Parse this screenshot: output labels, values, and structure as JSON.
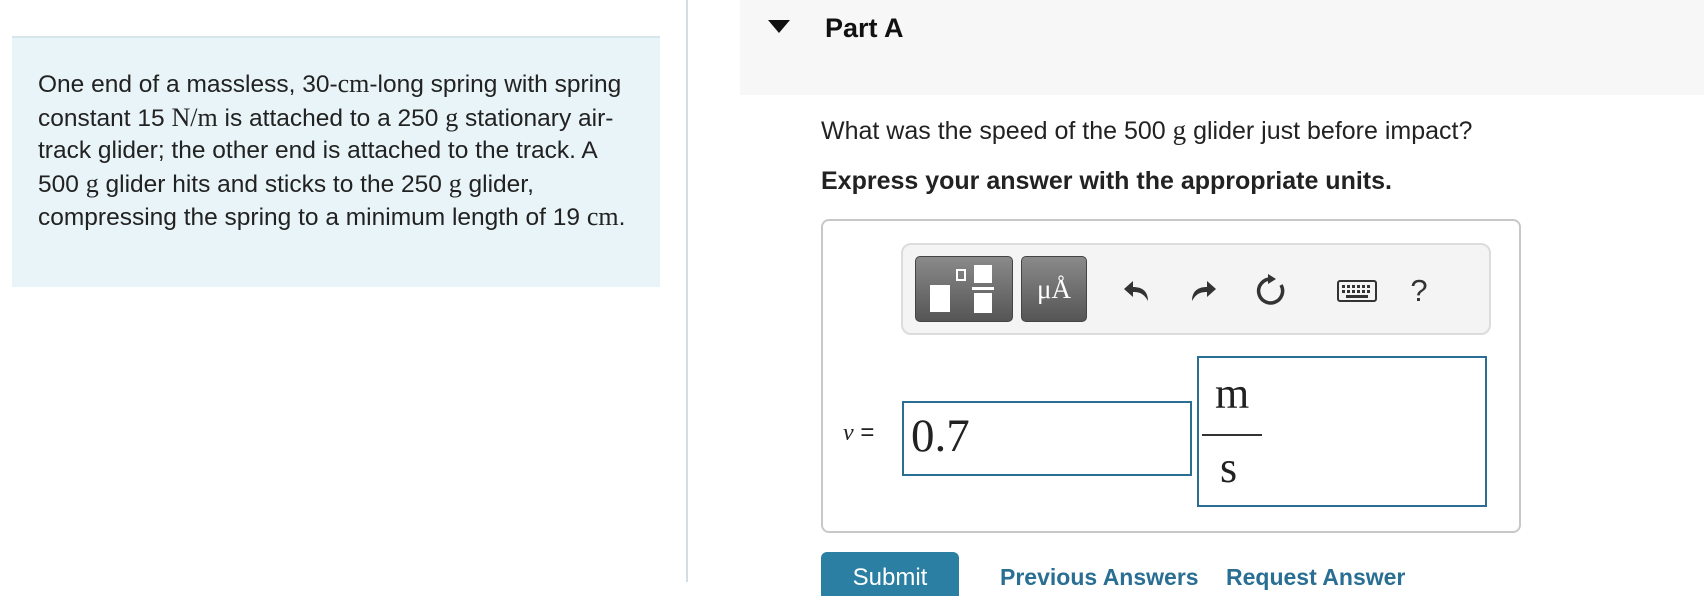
{
  "problem": {
    "text_parts": [
      "One end of a massless, 30-",
      "cm",
      "-long spring with spring constant 15 ",
      "N/m",
      " is attached to a 250 ",
      "g",
      " stationary air-track glider; the other end is attached to the track. A 500 ",
      "g",
      " glider hits and sticks to the 250 ",
      "g",
      " glider, compressing the spring to a minimum length of 19 ",
      "cm",
      "."
    ]
  },
  "part": {
    "title": "Part A"
  },
  "question": {
    "before": "What was the speed of the 500 ",
    "unit": "g",
    "after": " glider just before impact?"
  },
  "instruction": "Express your answer with the appropriate units.",
  "toolbar": {
    "units_button_label": "μÅ",
    "help_label": "?"
  },
  "answer": {
    "variable": "v",
    "equals": "=",
    "value": "0.7",
    "unit_numerator": "m",
    "unit_denominator": "s"
  },
  "actions": {
    "submit_label": "Submit",
    "previous_answers_label": "Previous Answers",
    "request_answer_label": "Request Answer"
  },
  "colors": {
    "problem_bg": "#e8f4f7",
    "accent": "#2a6f93",
    "submit_bg": "#2a7fa3"
  }
}
